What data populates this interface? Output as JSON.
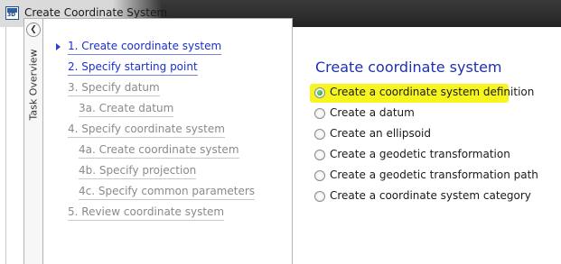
{
  "window": {
    "title": "Create Coordinate System",
    "icon": "app-3d-icon",
    "icon_text": "3D"
  },
  "task_overview": {
    "label": "Task Overview",
    "back_icon": "chevron-left-icon",
    "back_glyph": "❮",
    "steps": [
      {
        "label": "1. Create coordinate system",
        "state": "active"
      },
      {
        "label": "2. Specify starting point",
        "state": "active"
      },
      {
        "label": "3. Specify datum",
        "state": "disabled"
      },
      {
        "label": "3a. Create datum",
        "state": "disabled"
      },
      {
        "label": "4. Specify coordinate system",
        "state": "disabled"
      },
      {
        "label": "4a. Create coordinate system",
        "state": "disabled"
      },
      {
        "label": "4b. Specify projection",
        "state": "disabled"
      },
      {
        "label": "4c. Specify common parameters",
        "state": "disabled"
      },
      {
        "label": "5. Review coordinate system",
        "state": "disabled"
      }
    ]
  },
  "main": {
    "title": "Create coordinate system",
    "options": [
      {
        "label": "Create a coordinate system definition",
        "selected": true
      },
      {
        "label": "Create a datum",
        "selected": false
      },
      {
        "label": "Create an ellipsoid",
        "selected": false
      },
      {
        "label": "Create a geodetic transformation",
        "selected": false
      },
      {
        "label": "Create a geodetic transformation path",
        "selected": false
      },
      {
        "label": "Create a coordinate system category",
        "selected": false
      }
    ]
  },
  "colors": {
    "active_link": "#1a2fcf",
    "disabled_link": "#8a8a8a",
    "title": "#1f2fb8",
    "highlight": "#f7f51f",
    "radio_selected": "#0b8f1b"
  }
}
